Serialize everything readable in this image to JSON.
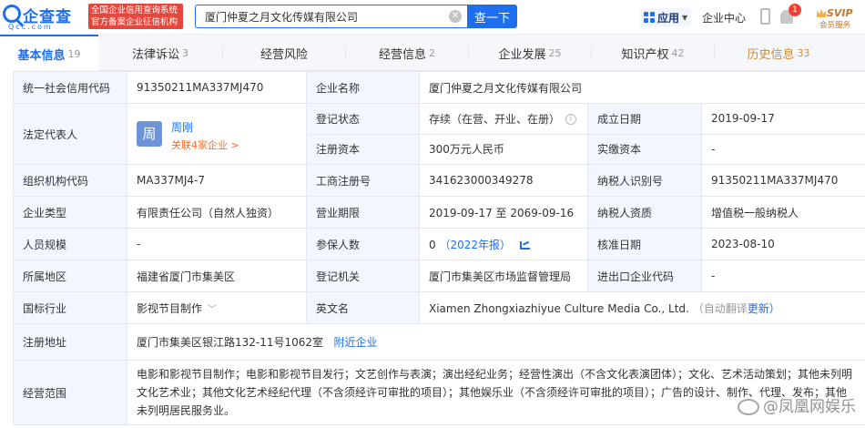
{
  "header": {
    "logo_text": "企查查",
    "logo_domain": "Qcc.com",
    "slogan_line1": "全国企业信用查询系统",
    "slogan_line2": "官方备案企业征信机构",
    "search_value": "厦门仲夏之月文化传媒有限公司",
    "search_button": "查一下",
    "apps_label": "应用",
    "enterprise_center": "企业中心",
    "notification_count": "1",
    "vip_title": "SVIP",
    "vip_sub": "会员服务"
  },
  "tabs": [
    {
      "label": "基本信息",
      "count": "19"
    },
    {
      "label": "法律诉讼",
      "count": "3"
    },
    {
      "label": "经营风险",
      "count": ""
    },
    {
      "label": "经营信息",
      "count": "2"
    },
    {
      "label": "企业发展",
      "count": "25"
    },
    {
      "label": "知识产权",
      "count": "42"
    },
    {
      "label": "历史信息",
      "count": "33"
    }
  ],
  "info": {
    "credit_code_label": "统一社会信用代码",
    "credit_code": "91350211MA337MJ470",
    "company_name_label": "企业名称",
    "company_name": "厦门仲夏之月文化传媒有限公司",
    "legal_rep_label": "法定代表人",
    "legal_rep_avatar": "周",
    "legal_rep_name": "周刚",
    "legal_rep_assoc": "关联4家企业 >",
    "reg_status_label": "登记状态",
    "reg_status": "存续（在营、开业、在册）",
    "est_date_label": "成立日期",
    "est_date": "2019-09-17",
    "reg_capital_label": "注册资本",
    "reg_capital": "300万元人民币",
    "paid_capital_label": "实缴资本",
    "paid_capital": "-",
    "org_code_label": "组织机构代码",
    "org_code": "MA337MJ4-7",
    "biz_reg_no_label": "工商注册号",
    "biz_reg_no": "341623000349278",
    "taxpayer_id_label": "纳税人识别号",
    "taxpayer_id": "91350211MA337MJ470",
    "company_type_label": "企业类型",
    "company_type": "有限责任公司（自然人独资）",
    "biz_term_label": "营业期限",
    "biz_term": "2019-09-17 至 2069-09-16",
    "taxpayer_qual_label": "纳税人资质",
    "taxpayer_qual": "增值税一般纳税人",
    "staff_size_label": "人员规模",
    "staff_size": "-",
    "insured_label": "参保人数",
    "insured_count": "0",
    "insured_year": "（2022年报）",
    "approval_date_label": "核准日期",
    "approval_date": "2023-08-10",
    "region_label": "所属地区",
    "region": "福建省厦门市集美区",
    "reg_authority_label": "登记机关",
    "reg_authority": "厦门市集美区市场监督管理局",
    "import_export_label": "进出口企业代码",
    "import_export": "-",
    "industry_label": "国标行业",
    "industry": "影视节目制作",
    "english_name_label": "英文名",
    "english_name": "Xiamen Zhongxiazhiyue Culture Media Co., Ltd.",
    "auto_translate": "（自动翻译",
    "update_link": "更新）",
    "address_label": "注册地址",
    "address": "厦门市集美区银江路132-11号1062室",
    "nearby_link": "附近企业",
    "scope_label": "经营范围",
    "scope": "电影和影视节目制作；电影和影视节目发行；文艺创作与表演；演出经纪业务；经营性演出（不含文化表演团体）；文化、艺术活动策划；其他未列明文化艺术业；其他文化艺术经纪代理（不含须经许可审批的项目）；其他娱乐业（不含须经许可审批的项目）；广告的设计、制作、代理、发布；其他未列明居民服务业。"
  },
  "watermark": "@凤凰网娱乐",
  "colors": {
    "brand_blue": "#1e6ff0",
    "label_bg": "#f2f7ff",
    "history_orange": "#d58b2e",
    "slogan_red": "#e5473c"
  }
}
